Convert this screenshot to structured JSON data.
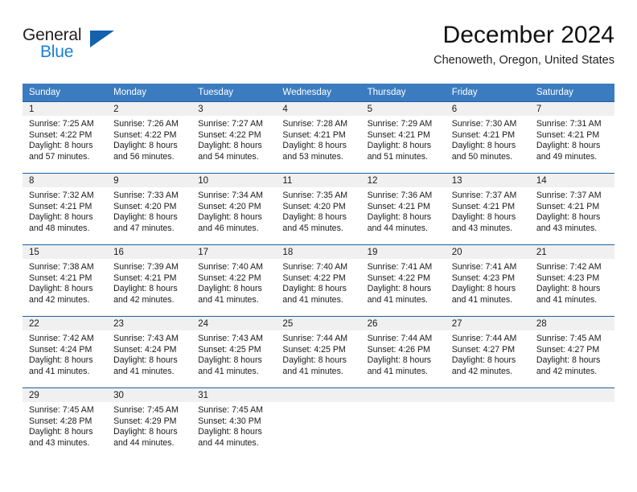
{
  "brand": {
    "name_part1": "General",
    "name_part2": "Blue",
    "logo_icon": "triangle-logo-icon",
    "accent_color": "#1b7fd4",
    "triangle_color": "#1262ad"
  },
  "header": {
    "month_title": "December 2024",
    "location": "Chenoweth, Oregon, United States"
  },
  "calendar": {
    "header_bg_color": "#3b7cc0",
    "daynum_bg_color": "#f0f0f0",
    "weekday_headers": [
      "Sunday",
      "Monday",
      "Tuesday",
      "Wednesday",
      "Thursday",
      "Friday",
      "Saturday"
    ],
    "weeks": [
      [
        {
          "day": "1",
          "sunrise": "Sunrise: 7:25 AM",
          "sunset": "Sunset: 4:22 PM",
          "daylight_line1": "Daylight: 8 hours",
          "daylight_line2": "and 57 minutes."
        },
        {
          "day": "2",
          "sunrise": "Sunrise: 7:26 AM",
          "sunset": "Sunset: 4:22 PM",
          "daylight_line1": "Daylight: 8 hours",
          "daylight_line2": "and 56 minutes."
        },
        {
          "day": "3",
          "sunrise": "Sunrise: 7:27 AM",
          "sunset": "Sunset: 4:22 PM",
          "daylight_line1": "Daylight: 8 hours",
          "daylight_line2": "and 54 minutes."
        },
        {
          "day": "4",
          "sunrise": "Sunrise: 7:28 AM",
          "sunset": "Sunset: 4:21 PM",
          "daylight_line1": "Daylight: 8 hours",
          "daylight_line2": "and 53 minutes."
        },
        {
          "day": "5",
          "sunrise": "Sunrise: 7:29 AM",
          "sunset": "Sunset: 4:21 PM",
          "daylight_line1": "Daylight: 8 hours",
          "daylight_line2": "and 51 minutes."
        },
        {
          "day": "6",
          "sunrise": "Sunrise: 7:30 AM",
          "sunset": "Sunset: 4:21 PM",
          "daylight_line1": "Daylight: 8 hours",
          "daylight_line2": "and 50 minutes."
        },
        {
          "day": "7",
          "sunrise": "Sunrise: 7:31 AM",
          "sunset": "Sunset: 4:21 PM",
          "daylight_line1": "Daylight: 8 hours",
          "daylight_line2": "and 49 minutes."
        }
      ],
      [
        {
          "day": "8",
          "sunrise": "Sunrise: 7:32 AM",
          "sunset": "Sunset: 4:21 PM",
          "daylight_line1": "Daylight: 8 hours",
          "daylight_line2": "and 48 minutes."
        },
        {
          "day": "9",
          "sunrise": "Sunrise: 7:33 AM",
          "sunset": "Sunset: 4:20 PM",
          "daylight_line1": "Daylight: 8 hours",
          "daylight_line2": "and 47 minutes."
        },
        {
          "day": "10",
          "sunrise": "Sunrise: 7:34 AM",
          "sunset": "Sunset: 4:20 PM",
          "daylight_line1": "Daylight: 8 hours",
          "daylight_line2": "and 46 minutes."
        },
        {
          "day": "11",
          "sunrise": "Sunrise: 7:35 AM",
          "sunset": "Sunset: 4:20 PM",
          "daylight_line1": "Daylight: 8 hours",
          "daylight_line2": "and 45 minutes."
        },
        {
          "day": "12",
          "sunrise": "Sunrise: 7:36 AM",
          "sunset": "Sunset: 4:21 PM",
          "daylight_line1": "Daylight: 8 hours",
          "daylight_line2": "and 44 minutes."
        },
        {
          "day": "13",
          "sunrise": "Sunrise: 7:37 AM",
          "sunset": "Sunset: 4:21 PM",
          "daylight_line1": "Daylight: 8 hours",
          "daylight_line2": "and 43 minutes."
        },
        {
          "day": "14",
          "sunrise": "Sunrise: 7:37 AM",
          "sunset": "Sunset: 4:21 PM",
          "daylight_line1": "Daylight: 8 hours",
          "daylight_line2": "and 43 minutes."
        }
      ],
      [
        {
          "day": "15",
          "sunrise": "Sunrise: 7:38 AM",
          "sunset": "Sunset: 4:21 PM",
          "daylight_line1": "Daylight: 8 hours",
          "daylight_line2": "and 42 minutes."
        },
        {
          "day": "16",
          "sunrise": "Sunrise: 7:39 AM",
          "sunset": "Sunset: 4:21 PM",
          "daylight_line1": "Daylight: 8 hours",
          "daylight_line2": "and 42 minutes."
        },
        {
          "day": "17",
          "sunrise": "Sunrise: 7:40 AM",
          "sunset": "Sunset: 4:22 PM",
          "daylight_line1": "Daylight: 8 hours",
          "daylight_line2": "and 41 minutes."
        },
        {
          "day": "18",
          "sunrise": "Sunrise: 7:40 AM",
          "sunset": "Sunset: 4:22 PM",
          "daylight_line1": "Daylight: 8 hours",
          "daylight_line2": "and 41 minutes."
        },
        {
          "day": "19",
          "sunrise": "Sunrise: 7:41 AM",
          "sunset": "Sunset: 4:22 PM",
          "daylight_line1": "Daylight: 8 hours",
          "daylight_line2": "and 41 minutes."
        },
        {
          "day": "20",
          "sunrise": "Sunrise: 7:41 AM",
          "sunset": "Sunset: 4:23 PM",
          "daylight_line1": "Daylight: 8 hours",
          "daylight_line2": "and 41 minutes."
        },
        {
          "day": "21",
          "sunrise": "Sunrise: 7:42 AM",
          "sunset": "Sunset: 4:23 PM",
          "daylight_line1": "Daylight: 8 hours",
          "daylight_line2": "and 41 minutes."
        }
      ],
      [
        {
          "day": "22",
          "sunrise": "Sunrise: 7:42 AM",
          "sunset": "Sunset: 4:24 PM",
          "daylight_line1": "Daylight: 8 hours",
          "daylight_line2": "and 41 minutes."
        },
        {
          "day": "23",
          "sunrise": "Sunrise: 7:43 AM",
          "sunset": "Sunset: 4:24 PM",
          "daylight_line1": "Daylight: 8 hours",
          "daylight_line2": "and 41 minutes."
        },
        {
          "day": "24",
          "sunrise": "Sunrise: 7:43 AM",
          "sunset": "Sunset: 4:25 PM",
          "daylight_line1": "Daylight: 8 hours",
          "daylight_line2": "and 41 minutes."
        },
        {
          "day": "25",
          "sunrise": "Sunrise: 7:44 AM",
          "sunset": "Sunset: 4:25 PM",
          "daylight_line1": "Daylight: 8 hours",
          "daylight_line2": "and 41 minutes."
        },
        {
          "day": "26",
          "sunrise": "Sunrise: 7:44 AM",
          "sunset": "Sunset: 4:26 PM",
          "daylight_line1": "Daylight: 8 hours",
          "daylight_line2": "and 41 minutes."
        },
        {
          "day": "27",
          "sunrise": "Sunrise: 7:44 AM",
          "sunset": "Sunset: 4:27 PM",
          "daylight_line1": "Daylight: 8 hours",
          "daylight_line2": "and 42 minutes."
        },
        {
          "day": "28",
          "sunrise": "Sunrise: 7:45 AM",
          "sunset": "Sunset: 4:27 PM",
          "daylight_line1": "Daylight: 8 hours",
          "daylight_line2": "and 42 minutes."
        }
      ],
      [
        {
          "day": "29",
          "sunrise": "Sunrise: 7:45 AM",
          "sunset": "Sunset: 4:28 PM",
          "daylight_line1": "Daylight: 8 hours",
          "daylight_line2": "and 43 minutes."
        },
        {
          "day": "30",
          "sunrise": "Sunrise: 7:45 AM",
          "sunset": "Sunset: 4:29 PM",
          "daylight_line1": "Daylight: 8 hours",
          "daylight_line2": "and 44 minutes."
        },
        {
          "day": "31",
          "sunrise": "Sunrise: 7:45 AM",
          "sunset": "Sunset: 4:30 PM",
          "daylight_line1": "Daylight: 8 hours",
          "daylight_line2": "and 44 minutes."
        },
        {
          "day": "",
          "sunrise": "",
          "sunset": "",
          "daylight_line1": "",
          "daylight_line2": ""
        },
        {
          "day": "",
          "sunrise": "",
          "sunset": "",
          "daylight_line1": "",
          "daylight_line2": ""
        },
        {
          "day": "",
          "sunrise": "",
          "sunset": "",
          "daylight_line1": "",
          "daylight_line2": ""
        },
        {
          "day": "",
          "sunrise": "",
          "sunset": "",
          "daylight_line1": "",
          "daylight_line2": ""
        }
      ]
    ]
  }
}
